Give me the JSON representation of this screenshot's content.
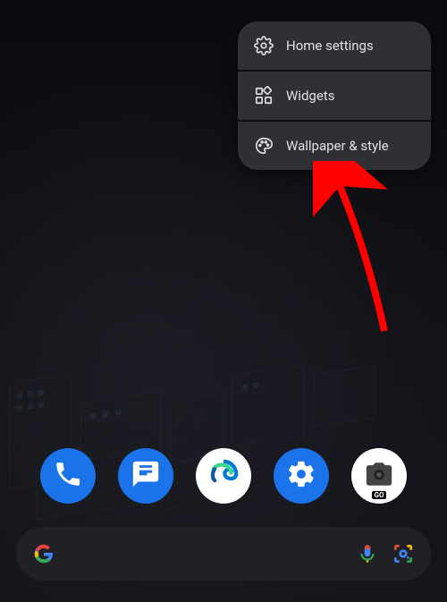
{
  "menu": {
    "items": [
      {
        "label": "Home settings",
        "icon": "gear-icon"
      },
      {
        "label": "Widgets",
        "icon": "widgets-icon"
      },
      {
        "label": "Wallpaper & style",
        "icon": "palette-icon"
      }
    ]
  },
  "dock": {
    "apps": [
      {
        "name": "phone-app",
        "icon": "phone-icon"
      },
      {
        "name": "messages-app",
        "icon": "messages-icon"
      },
      {
        "name": "edge-app",
        "icon": "edge-icon"
      },
      {
        "name": "settings-app",
        "icon": "settings-icon"
      },
      {
        "name": "camera-go-app",
        "icon": "camera-icon",
        "badge": "GO"
      }
    ]
  },
  "search": {
    "placeholder": "",
    "voice_icon": "mic-icon",
    "lens_icon": "lens-icon"
  },
  "annotation": {
    "arrow_color": "#ff0000",
    "target": "menu.items.2"
  }
}
